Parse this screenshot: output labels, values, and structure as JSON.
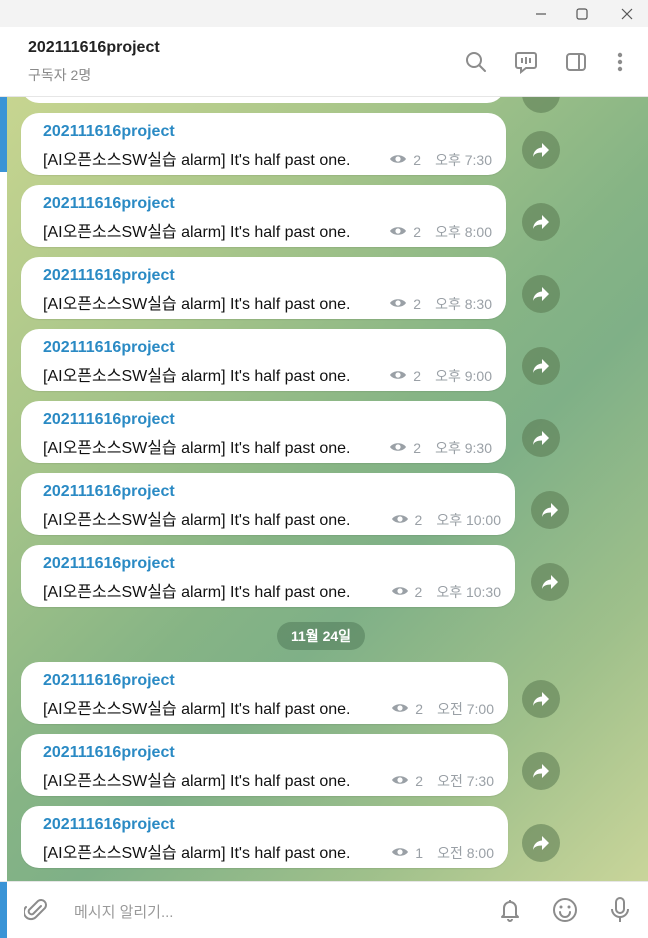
{
  "window": {
    "controls": [
      "minimize-icon",
      "maximize-icon",
      "close-icon"
    ]
  },
  "header": {
    "title": "202111616project",
    "subtitle": "구독자 2명",
    "icons": [
      "search-icon",
      "live-stream-icon",
      "sidebar-toggle-icon",
      "more-vertical-icon"
    ]
  },
  "chat": {
    "messages": [
      {
        "sender": "202111616project",
        "text": "[AI오픈소스SW실습 alarm] It's half past one.",
        "views": "2",
        "time": "오후 7:30"
      },
      {
        "sender": "202111616project",
        "text": "[AI오픈소스SW실습 alarm] It's half past one.",
        "views": "2",
        "time": "오후 8:00"
      },
      {
        "sender": "202111616project",
        "text": "[AI오픈소스SW실습 alarm] It's half past one.",
        "views": "2",
        "time": "오후 8:30"
      },
      {
        "sender": "202111616project",
        "text": "[AI오픈소스SW실습 alarm] It's half past one.",
        "views": "2",
        "time": "오후 9:00"
      },
      {
        "sender": "202111616project",
        "text": "[AI오픈소스SW실습 alarm] It's half past one.",
        "views": "2",
        "time": "오후 9:30"
      },
      {
        "sender": "202111616project",
        "text": "[AI오픈소스SW실습 alarm] It's half past one.",
        "views": "2",
        "time": "오후 10:00"
      },
      {
        "sender": "202111616project",
        "text": "[AI오픈소스SW실습 alarm] It's half past one.",
        "views": "2",
        "time": "오후 10:30"
      },
      {
        "sender": "202111616project",
        "text": "[AI오픈소스SW실습 alarm] It's half past one.",
        "views": "2",
        "time": "오전 7:00"
      },
      {
        "sender": "202111616project",
        "text": "[AI오픈소스SW실습 alarm] It's half past one.",
        "views": "2",
        "time": "오전 7:30"
      },
      {
        "sender": "202111616project",
        "text": "[AI오픈소스SW실습 alarm] It's half past one.",
        "views": "1",
        "time": "오전 8:00"
      }
    ],
    "date_separator": "11월 24일"
  },
  "composer": {
    "placeholder": "메시지 알리기...",
    "icons": [
      "attach-icon",
      "bell-icon",
      "emoji-icon",
      "microphone-icon"
    ]
  },
  "colors": {
    "accent": "#3a94d6",
    "sender_name": "#2a8ac4",
    "bubble": "#ffffff"
  }
}
